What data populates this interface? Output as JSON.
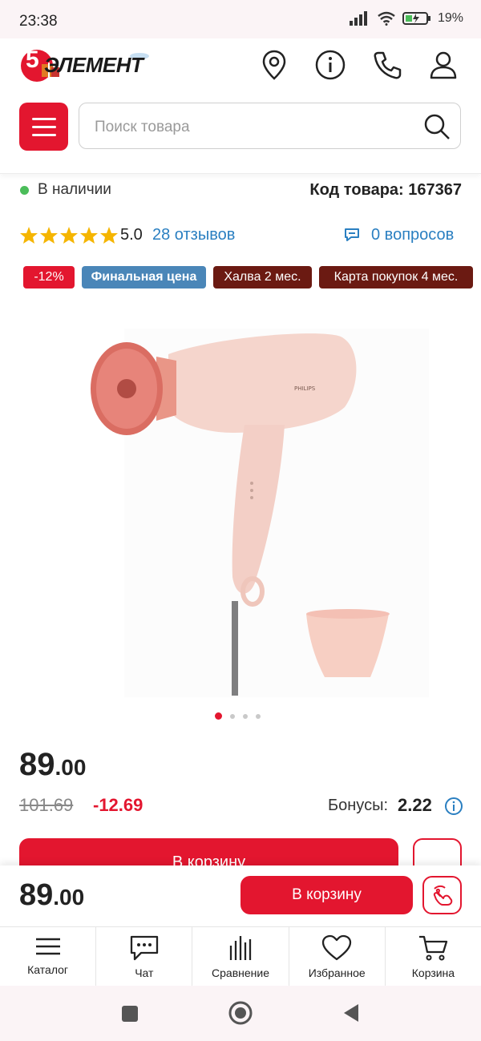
{
  "status_bar": {
    "time": "23:38",
    "battery": "19%"
  },
  "header": {
    "logo_text": "ЭЛЕМЕНТ",
    "logo_number": "5",
    "search_placeholder": "Поиск товара"
  },
  "product": {
    "availability": "В наличии",
    "code": "Код товара: 167367",
    "rating": "5.0",
    "stars": 5,
    "reviews": "28 отзывов",
    "questions": "0 вопросов",
    "brand_on_image": "PHILIPS",
    "badges": [
      {
        "label": "-12%",
        "color": "#e3162f"
      },
      {
        "label": "Финальная цена",
        "color": "#4a86b8"
      },
      {
        "label": "Халва 2 мес.",
        "color": "#6b1a12"
      },
      {
        "label": "Карта покупок 4 мес.",
        "color": "#6b1a12"
      }
    ],
    "gallery": {
      "count": 4,
      "active": 1
    },
    "price_int": "89",
    "price_frac": ".00",
    "old_price": "101.69",
    "discount": "-12.69",
    "bonus_label": "Бонусы:",
    "bonus_value": "2.22",
    "add_to_cart": "В корзину"
  },
  "sticky_bar": {
    "price_int": "89",
    "price_frac": ".00",
    "add_to_cart": "В корзину"
  },
  "bottom_nav": [
    {
      "label": "Каталог",
      "icon": "menu-icon"
    },
    {
      "label": "Чат",
      "icon": "chat-icon"
    },
    {
      "label": "Сравнение",
      "icon": "compare-icon"
    },
    {
      "label": "Избранное",
      "icon": "heart-icon"
    },
    {
      "label": "Корзина",
      "icon": "cart-icon"
    }
  ],
  "colors": {
    "brand_red": "#e3162f",
    "link_blue": "#2a7fc1",
    "in_stock_green": "#4bbd5a"
  }
}
